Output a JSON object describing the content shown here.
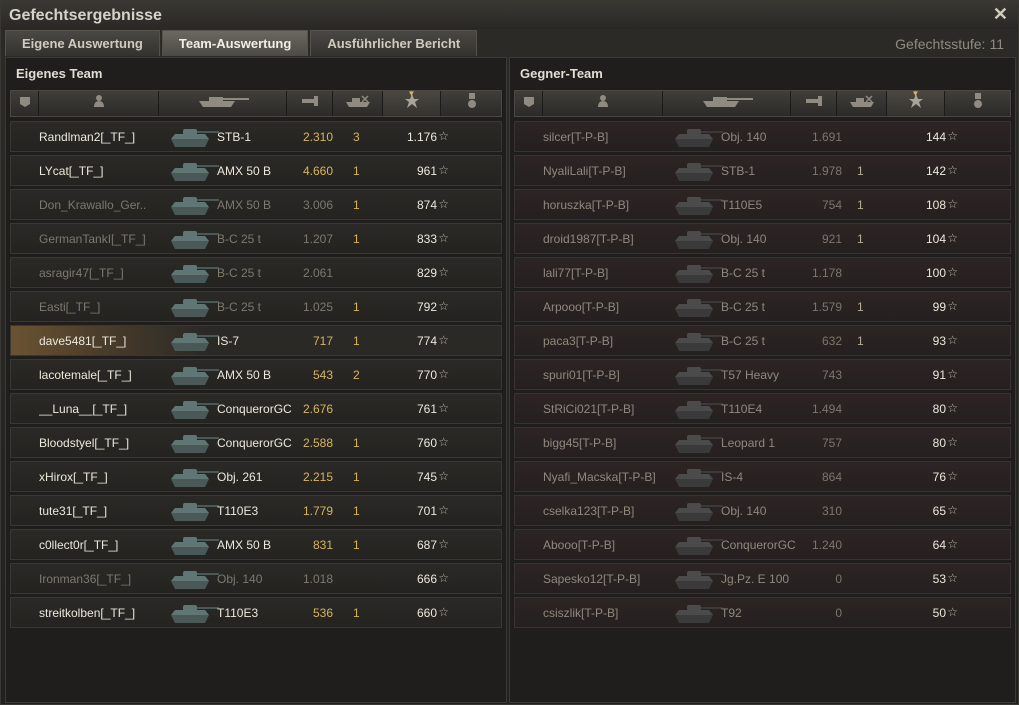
{
  "window": {
    "title": "Gefechtsergebnisse"
  },
  "tabs": [
    {
      "label": "Eigene Auswertung"
    },
    {
      "label": "Team-Auswertung"
    },
    {
      "label": "Ausführlicher Bericht"
    }
  ],
  "level": {
    "label": "Gefechtsstufe:",
    "value": "11"
  },
  "icons": {
    "close": "close-icon",
    "vehicle_status": "vehicle-status-icon",
    "player": "player-icon",
    "tank": "tank-icon",
    "damage": "damage-icon",
    "kills": "kills-icon",
    "xp": "star-icon",
    "medal": "medal-icon"
  },
  "colors": {
    "damage": "#d7b45e",
    "self_highlight": "#6a5332",
    "enemy_row": "#2d2524"
  },
  "own_team": {
    "title": "Eigenes Team",
    "rows": [
      {
        "player": "Randlman2[_TF_]",
        "tank": "STB-1",
        "damage": "2.310",
        "kills": "3",
        "xp": "1.176",
        "dead": false,
        "self": false
      },
      {
        "player": "LYcat[_TF_]",
        "tank": "AMX 50 B",
        "damage": "4.660",
        "kills": "1",
        "xp": "961",
        "dead": false,
        "self": false
      },
      {
        "player": "Don_Krawallo_Ger..",
        "tank": "AMX 50 B",
        "damage": "3.006",
        "kills": "1",
        "xp": "874",
        "dead": true,
        "self": false
      },
      {
        "player": "GermanTankI[_TF_]",
        "tank": "B-C 25 t",
        "damage": "1.207",
        "kills": "1",
        "xp": "833",
        "dead": true,
        "self": false
      },
      {
        "player": "asragir47[_TF_]",
        "tank": "B-C 25 t",
        "damage": "2.061",
        "kills": "",
        "xp": "829",
        "dead": true,
        "self": false
      },
      {
        "player": "Easti[_TF_]",
        "tank": "B-C 25 t",
        "damage": "1.025",
        "kills": "1",
        "xp": "792",
        "dead": true,
        "self": false
      },
      {
        "player": "dave5481[_TF_]",
        "tank": "IS-7",
        "damage": "717",
        "kills": "1",
        "xp": "774",
        "dead": false,
        "self": true
      },
      {
        "player": "lacotemale[_TF_]",
        "tank": "AMX 50 B",
        "damage": "543",
        "kills": "2",
        "xp": "770",
        "dead": false,
        "self": false
      },
      {
        "player": "__Luna__[_TF_]",
        "tank": "ConquerorGC",
        "damage": "2.676",
        "kills": "",
        "xp": "761",
        "dead": false,
        "self": false
      },
      {
        "player": "Bloodstyel[_TF_]",
        "tank": "ConquerorGC",
        "damage": "2.588",
        "kills": "1",
        "xp": "760",
        "dead": false,
        "self": false
      },
      {
        "player": "xHirox[_TF_]",
        "tank": "Obj. 261",
        "damage": "2.215",
        "kills": "1",
        "xp": "745",
        "dead": false,
        "self": false
      },
      {
        "player": "tute31[_TF_]",
        "tank": "T110E3",
        "damage": "1.779",
        "kills": "1",
        "xp": "701",
        "dead": false,
        "self": false
      },
      {
        "player": "c0llect0r[_TF_]",
        "tank": "AMX 50 B",
        "damage": "831",
        "kills": "1",
        "xp": "687",
        "dead": false,
        "self": false
      },
      {
        "player": "Ironman36[_TF_]",
        "tank": "Obj. 140",
        "damage": "1.018",
        "kills": "",
        "xp": "666",
        "dead": true,
        "self": false
      },
      {
        "player": "streitkolben[_TF_]",
        "tank": "T110E3",
        "damage": "536",
        "kills": "1",
        "xp": "660",
        "dead": false,
        "self": false
      }
    ]
  },
  "enemy_team": {
    "title": "Gegner-Team",
    "rows": [
      {
        "player": "silcer[T-P-B]",
        "tank": "Obj. 140",
        "damage": "1.691",
        "kills": "",
        "xp": "144"
      },
      {
        "player": "NyaliLali[T-P-B]",
        "tank": "STB-1",
        "damage": "1.978",
        "kills": "1",
        "xp": "142"
      },
      {
        "player": "horuszka[T-P-B]",
        "tank": "T110E5",
        "damage": "754",
        "kills": "1",
        "xp": "108"
      },
      {
        "player": "droid1987[T-P-B]",
        "tank": "Obj. 140",
        "damage": "921",
        "kills": "1",
        "xp": "104"
      },
      {
        "player": "lali77[T-P-B]",
        "tank": "B-C 25 t",
        "damage": "1.178",
        "kills": "",
        "xp": "100"
      },
      {
        "player": "Arpooo[T-P-B]",
        "tank": "B-C 25 t",
        "damage": "1.579",
        "kills": "1",
        "xp": "99"
      },
      {
        "player": "paca3[T-P-B]",
        "tank": "B-C 25 t",
        "damage": "632",
        "kills": "1",
        "xp": "93"
      },
      {
        "player": "spuri01[T-P-B]",
        "tank": "T57 Heavy",
        "damage": "743",
        "kills": "",
        "xp": "91"
      },
      {
        "player": "StRiCi021[T-P-B]",
        "tank": "T110E4",
        "damage": "1.494",
        "kills": "",
        "xp": "80"
      },
      {
        "player": "bigg45[T-P-B]",
        "tank": "Leopard 1",
        "damage": "757",
        "kills": "",
        "xp": "80"
      },
      {
        "player": "Nyafi_Macska[T-P-B]",
        "tank": "IS-4",
        "damage": "864",
        "kills": "",
        "xp": "76"
      },
      {
        "player": "cselka123[T-P-B]",
        "tank": "Obj. 140",
        "damage": "310",
        "kills": "",
        "xp": "65"
      },
      {
        "player": "Abooo[T-P-B]",
        "tank": "ConquerorGC",
        "damage": "1.240",
        "kills": "",
        "xp": "64"
      },
      {
        "player": "Sapesko12[T-P-B]",
        "tank": "Jg.Pz. E 100",
        "damage": "0",
        "kills": "",
        "xp": "53"
      },
      {
        "player": "csiszlik[T-P-B]",
        "tank": "T92",
        "damage": "0",
        "kills": "",
        "xp": "50"
      }
    ]
  }
}
